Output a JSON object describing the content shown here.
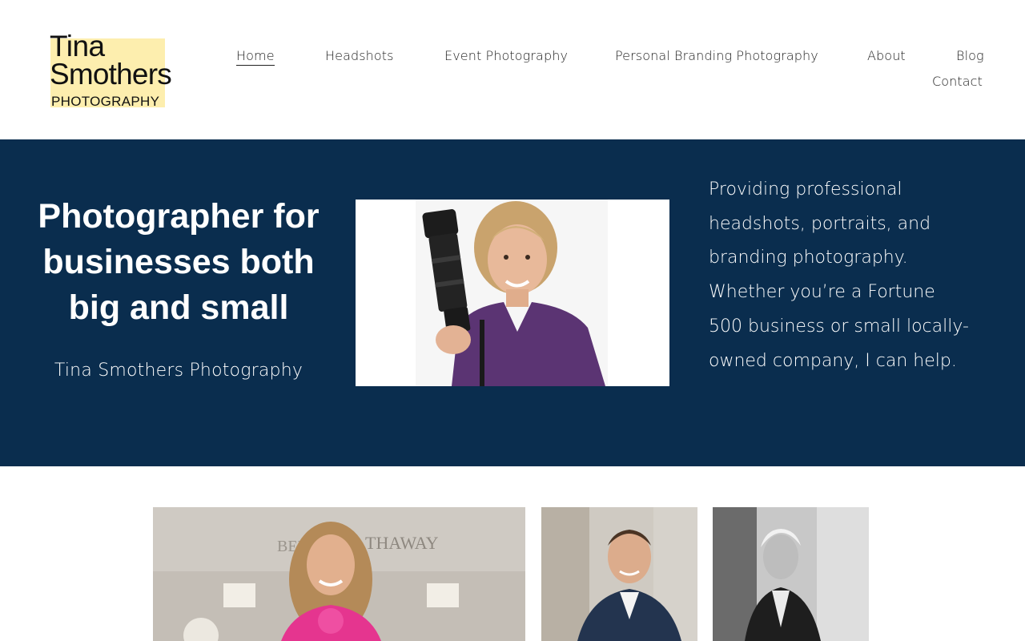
{
  "logo": {
    "line1": "Tina",
    "line2": "Smothers",
    "line3": "PHOTOGRAPHY",
    "accent_color": "#fdeeae"
  },
  "nav": {
    "items": [
      {
        "label": "Home",
        "active": true
      },
      {
        "label": "Headshots",
        "active": false
      },
      {
        "label": "Event Photography",
        "active": false
      },
      {
        "label": "Personal Branding Photography",
        "active": false
      },
      {
        "label": "About",
        "active": false
      },
      {
        "label": "Blog",
        "active": false
      },
      {
        "label": "Contact",
        "active": false
      }
    ]
  },
  "hero": {
    "background_color": "#0a2d4e",
    "title": "Photographer for businesses both big and small",
    "subtitle": "Tina Smothers Photography",
    "description": "Providing professional headshots, portraits, and branding photography. Whether you’re a Fortune 500 business or small locally-owned company, I can help."
  },
  "gallery": {
    "sign_text": "THAWAY"
  }
}
